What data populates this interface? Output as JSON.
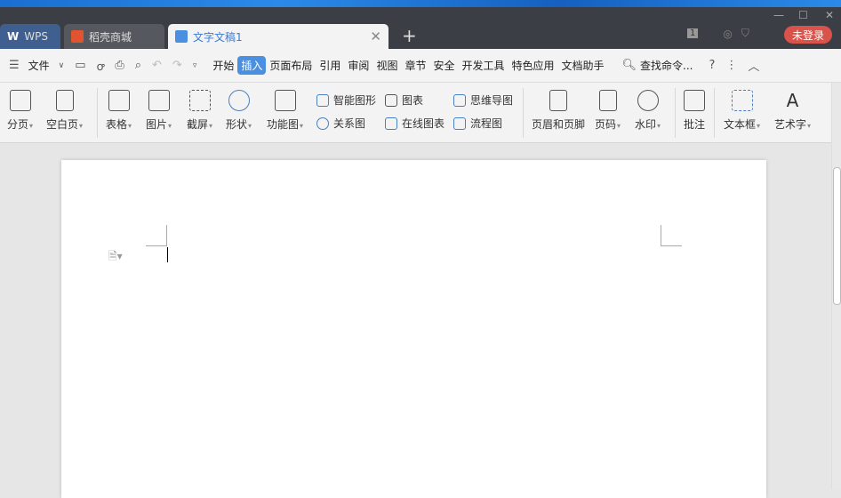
{
  "tabs": [
    {
      "label": "WPS"
    },
    {
      "label": "稻壳商城"
    },
    {
      "label": "文字文稿1"
    }
  ],
  "titlebar": {
    "page_count": "1",
    "login": "未登录",
    "minimize": "—",
    "maximize": "☐",
    "close": "✕"
  },
  "menu": {
    "file": "文件",
    "items": [
      "开始",
      "插入",
      "页面布局",
      "引用",
      "审阅",
      "视图",
      "章节",
      "安全",
      "开发工具",
      "特色应用",
      "文档助手"
    ],
    "active": "插入",
    "search": "查找命令...",
    "help": "?",
    "more": "⋮",
    "collapse": "︿"
  },
  "ribbon": {
    "page_break": "分页",
    "blank_page": "空白页",
    "table": "表格",
    "picture": "图片",
    "screenshot": "截屏",
    "shape": "形状",
    "function_chart": "功能图",
    "smart_shape": "智能图形",
    "chart": "图表",
    "mind_map": "思维导图",
    "relation": "关系图",
    "online_chart": "在线图表",
    "flowchart": "流程图",
    "header_footer": "页眉和页脚",
    "page_number": "页码",
    "watermark": "水印",
    "comment": "批注",
    "text_box": "文本框",
    "word_art": "艺术字"
  },
  "colors": {
    "accent": "#4a8fe0",
    "login": "#d9534a"
  }
}
